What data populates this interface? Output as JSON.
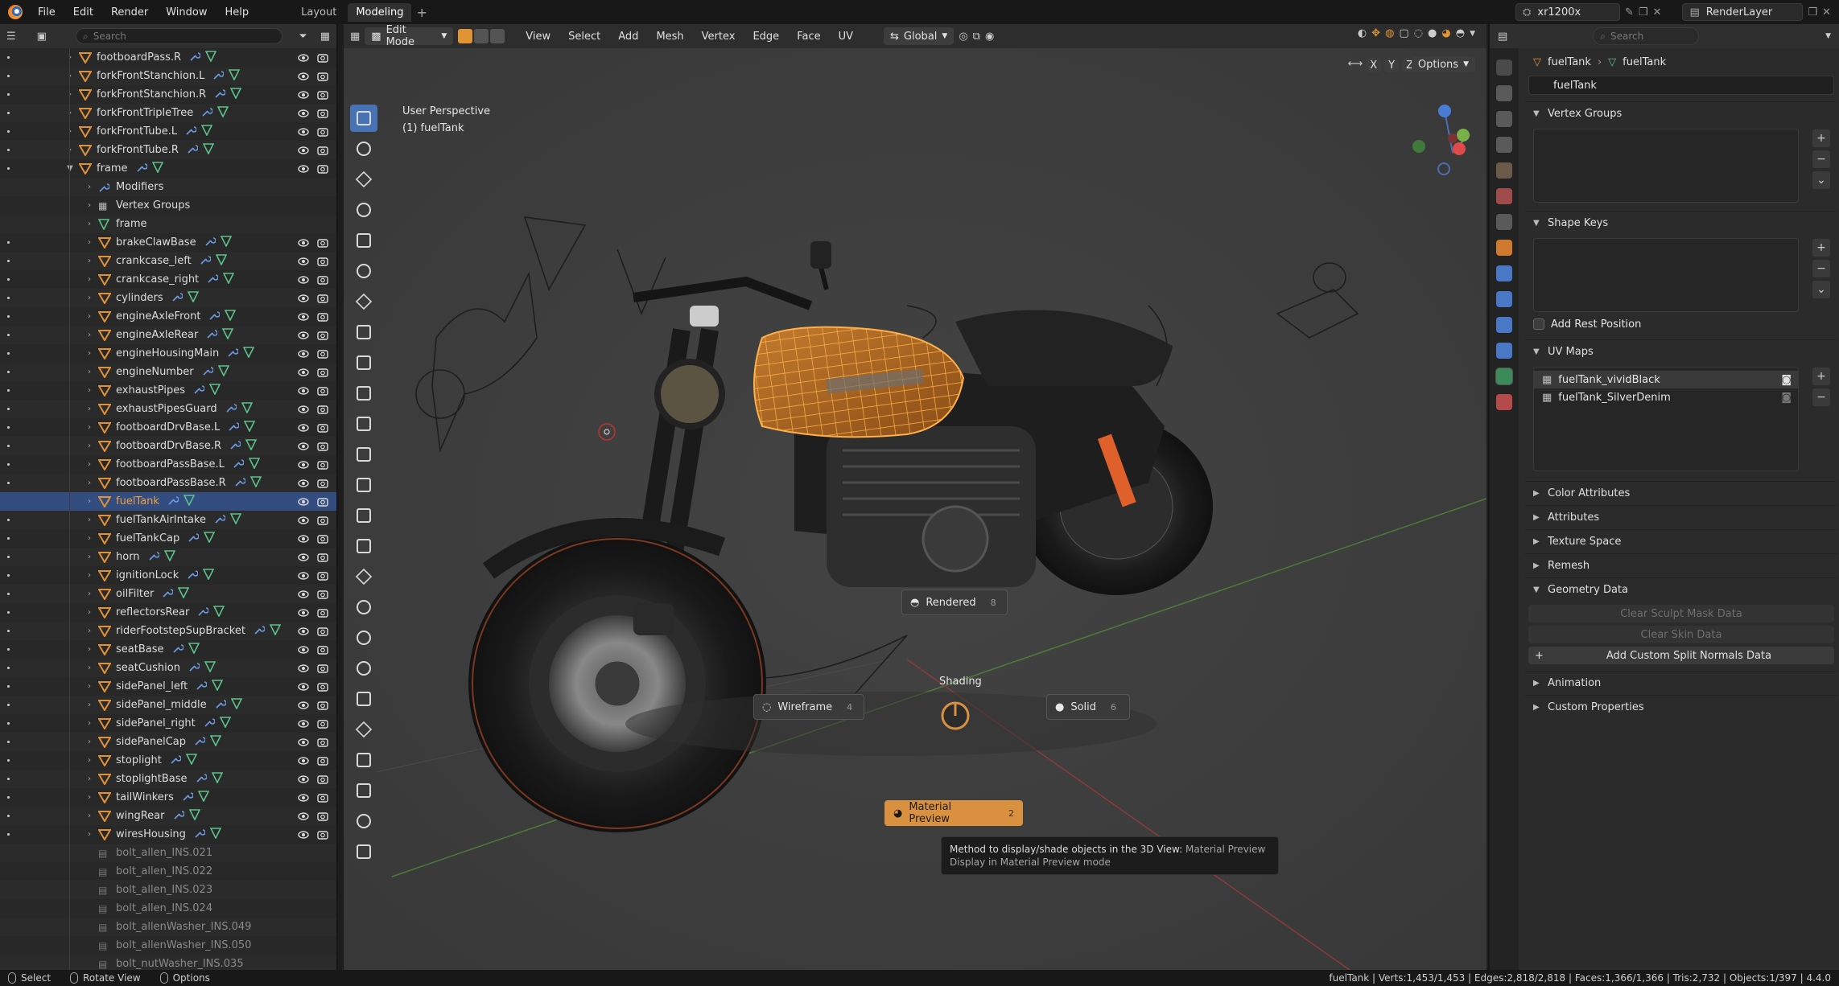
{
  "app": {
    "menus": [
      "File",
      "Edit",
      "Render",
      "Window",
      "Help"
    ],
    "workspaces": [
      {
        "label": "Layout",
        "active": false
      },
      {
        "label": "Modeling",
        "active": true
      }
    ],
    "scene_name": "xr1200x",
    "view_layer": "RenderLayer",
    "accent": "#e09434",
    "selection_blue": "#334d80"
  },
  "outliner": {
    "search_placeholder": "Search",
    "rows": [
      {
        "name": "footboardPass.R",
        "indent": 0,
        "visible": true,
        "dot": true
      },
      {
        "name": "forkFrontStanchion.L",
        "indent": 0,
        "visible": true,
        "dot": true
      },
      {
        "name": "forkFrontStanchion.R",
        "indent": 0,
        "visible": true,
        "dot": true
      },
      {
        "name": "forkFrontTripleTree",
        "indent": 0,
        "visible": true,
        "dot": true
      },
      {
        "name": "forkFrontTube.L",
        "indent": 0,
        "visible": true,
        "dot": true
      },
      {
        "name": "forkFrontTube.R",
        "indent": 0,
        "visible": true,
        "dot": true
      },
      {
        "name": "frame",
        "indent": 0,
        "visible": true,
        "dot": true,
        "expanded": true
      },
      {
        "name": "Modifiers",
        "indent": 1,
        "visible": false,
        "dot": false,
        "kind": "modifiers"
      },
      {
        "name": "Vertex Groups",
        "indent": 1,
        "visible": false,
        "dot": false,
        "kind": "vgroups"
      },
      {
        "name": "frame",
        "indent": 1,
        "visible": false,
        "dot": false,
        "kind": "mesh"
      },
      {
        "name": "brakeClawBase",
        "indent": 1,
        "visible": true,
        "dot": true
      },
      {
        "name": "crankcase_left",
        "indent": 1,
        "visible": true,
        "dot": true
      },
      {
        "name": "crankcase_right",
        "indent": 1,
        "visible": true,
        "dot": true
      },
      {
        "name": "cylinders",
        "indent": 1,
        "visible": true,
        "dot": true
      },
      {
        "name": "engineAxleFront",
        "indent": 1,
        "visible": true,
        "dot": true
      },
      {
        "name": "engineAxleRear",
        "indent": 1,
        "visible": true,
        "dot": true
      },
      {
        "name": "engineHousingMain",
        "indent": 1,
        "visible": true,
        "dot": true
      },
      {
        "name": "engineNumber",
        "indent": 1,
        "visible": true,
        "dot": true
      },
      {
        "name": "exhaustPipes",
        "indent": 1,
        "visible": true,
        "dot": true
      },
      {
        "name": "exhaustPipesGuard",
        "indent": 1,
        "visible": true,
        "dot": true
      },
      {
        "name": "footboardDrvBase.L",
        "indent": 1,
        "visible": true,
        "dot": true
      },
      {
        "name": "footboardDrvBase.R",
        "indent": 1,
        "visible": true,
        "dot": true
      },
      {
        "name": "footboardPassBase.L",
        "indent": 1,
        "visible": true,
        "dot": true
      },
      {
        "name": "footboardPassBase.R",
        "indent": 1,
        "visible": true,
        "dot": true
      },
      {
        "name": "fuelTank",
        "indent": 1,
        "visible": true,
        "dot": false,
        "selected": true
      },
      {
        "name": "fuelTankAirIntake",
        "indent": 1,
        "visible": true,
        "dot": true
      },
      {
        "name": "fuelTankCap",
        "indent": 1,
        "visible": true,
        "dot": true
      },
      {
        "name": "horn",
        "indent": 1,
        "visible": true,
        "dot": true
      },
      {
        "name": "ignitionLock",
        "indent": 1,
        "visible": true,
        "dot": true
      },
      {
        "name": "oilFilter",
        "indent": 1,
        "visible": true,
        "dot": true
      },
      {
        "name": "reflectorsRear",
        "indent": 1,
        "visible": true,
        "dot": true
      },
      {
        "name": "riderFootstepSupBracket",
        "indent": 1,
        "visible": true,
        "dot": true
      },
      {
        "name": "seatBase",
        "indent": 1,
        "visible": true,
        "dot": true
      },
      {
        "name": "seatCushion",
        "indent": 1,
        "visible": true,
        "dot": true
      },
      {
        "name": "sidePanel_left",
        "indent": 1,
        "visible": true,
        "dot": true
      },
      {
        "name": "sidePanel_middle",
        "indent": 1,
        "visible": true,
        "dot": true
      },
      {
        "name": "sidePanel_right",
        "indent": 1,
        "visible": true,
        "dot": true
      },
      {
        "name": "sidePanelCap",
        "indent": 1,
        "visible": true,
        "dot": true
      },
      {
        "name": "stoplight",
        "indent": 1,
        "visible": true,
        "dot": true
      },
      {
        "name": "stoplightBase",
        "indent": 1,
        "visible": true,
        "dot": true
      },
      {
        "name": "tailWinkers",
        "indent": 1,
        "visible": true,
        "dot": true
      },
      {
        "name": "wingRear",
        "indent": 1,
        "visible": true,
        "dot": true
      },
      {
        "name": "wiresHousing",
        "indent": 1,
        "visible": true,
        "dot": true
      },
      {
        "name": "bolt_allen_INS.021",
        "indent": 1,
        "visible": false,
        "dot": false,
        "dim": true
      },
      {
        "name": "bolt_allen_INS.022",
        "indent": 1,
        "visible": false,
        "dot": false,
        "dim": true
      },
      {
        "name": "bolt_allen_INS.023",
        "indent": 1,
        "visible": false,
        "dot": false,
        "dim": true
      },
      {
        "name": "bolt_allen_INS.024",
        "indent": 1,
        "visible": false,
        "dot": false,
        "dim": true
      },
      {
        "name": "bolt_allenWasher_INS.049",
        "indent": 1,
        "visible": false,
        "dot": false,
        "dim": true
      },
      {
        "name": "bolt_allenWasher_INS.050",
        "indent": 1,
        "visible": false,
        "dot": false,
        "dim": true
      },
      {
        "name": "bolt_nutWasher_INS.035",
        "indent": 1,
        "visible": false,
        "dot": false,
        "dim": true
      }
    ]
  },
  "viewport": {
    "mode": "Edit Mode",
    "menus": [
      "View",
      "Select",
      "Add",
      "Mesh",
      "Vertex",
      "Edge",
      "Face",
      "UV"
    ],
    "orientation": "Global",
    "options_label": "Options",
    "axis_labels": [
      "X",
      "Y",
      "Z"
    ],
    "info_line1": "User Perspective",
    "info_line2": "(1) fuelTank",
    "pie": {
      "title": "Shading",
      "items": [
        {
          "label": "Rendered",
          "shortcut": "8",
          "active": false
        },
        {
          "label": "Wireframe",
          "shortcut": "4",
          "active": false
        },
        {
          "label": "Solid",
          "shortcut": "6",
          "active": false
        },
        {
          "label": "Material Preview",
          "shortcut": "2",
          "active": true
        }
      ]
    },
    "tooltip": {
      "prefix": "Method to display/shade objects in the 3D View:",
      "value": "Material Preview",
      "detail": "Display in Material Preview mode"
    }
  },
  "properties": {
    "search_placeholder": "Search",
    "breadcrumb": [
      "fuelTank",
      "fuelTank"
    ],
    "data_name": "fuelTank",
    "panels": {
      "vertex_groups": "Vertex Groups",
      "shape_keys": "Shape Keys",
      "add_rest_position": "Add Rest Position",
      "uv_maps": "UV Maps",
      "color_attributes": "Color Attributes",
      "attributes": "Attributes",
      "texture_space": "Texture Space",
      "remesh": "Remesh",
      "geometry_data": "Geometry Data",
      "clear_sculpt": "Clear Sculpt Mask Data",
      "clear_skin": "Clear Skin Data",
      "add_split_normals": "Add Custom Split Normals Data",
      "animation": "Animation",
      "custom_properties": "Custom Properties"
    },
    "uv_maps": [
      {
        "name": "fuelTank_vividBlack",
        "active_render": true
      },
      {
        "name": "fuelTank_SilverDenim",
        "active_render": false
      }
    ]
  },
  "statusbar": {
    "hints": [
      "Select",
      "Rotate View",
      "Options"
    ],
    "stats": "fuelTank | Verts:1,453/1,453 | Edges:2,818/2,818 | Faces:1,366/1,366 | Tris:2,732 | Objects:1/397 | 4.4.0"
  }
}
